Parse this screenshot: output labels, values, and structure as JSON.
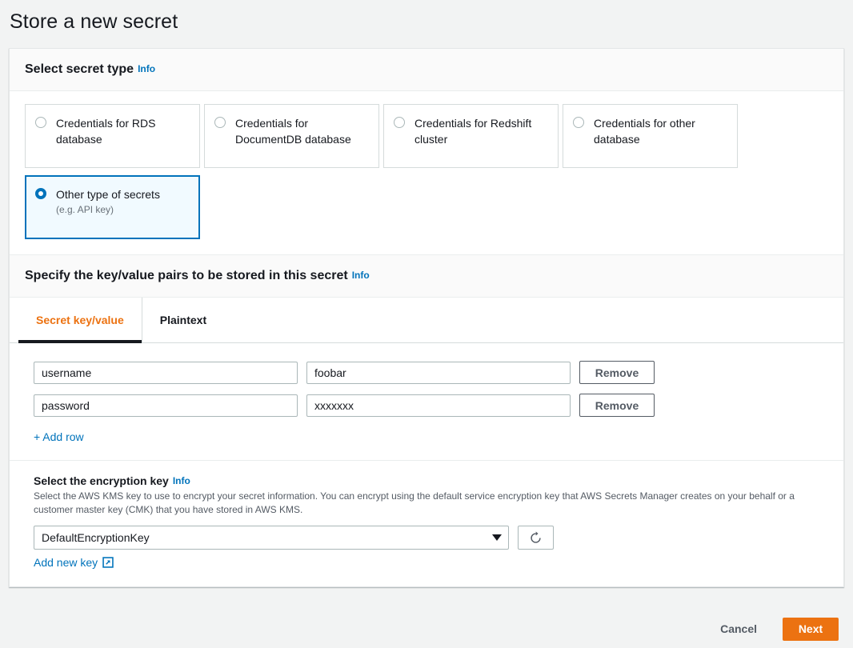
{
  "page": {
    "title": "Store a new secret"
  },
  "secret_type_section": {
    "heading": "Select secret type",
    "info_label": "Info",
    "options": [
      {
        "label": "Credentials for RDS database",
        "sub": "",
        "selected": false
      },
      {
        "label": "Credentials for DocumentDB database",
        "sub": "",
        "selected": false
      },
      {
        "label": "Credentials for Redshift cluster",
        "sub": "",
        "selected": false
      },
      {
        "label": "Credentials for other database",
        "sub": "",
        "selected": false
      },
      {
        "label": "Other type of secrets",
        "sub": "(e.g. API key)",
        "selected": true
      }
    ]
  },
  "keyvalue_section": {
    "heading": "Specify the key/value pairs to be stored in this secret",
    "info_label": "Info",
    "tabs": [
      {
        "label": "Secret key/value",
        "active": true
      },
      {
        "label": "Plaintext",
        "active": false
      }
    ],
    "rows": [
      {
        "key": "username",
        "value": "foobar",
        "remove_label": "Remove"
      },
      {
        "key": "password",
        "value": "xxxxxxx",
        "remove_label": "Remove"
      }
    ],
    "add_row_label": "+ Add row"
  },
  "encryption_section": {
    "heading": "Select the encryption key",
    "info_label": "Info",
    "description": "Select the AWS KMS key to use to encrypt your secret information. You can encrypt using the default service encryption key that AWS Secrets Manager creates on your behalf or a customer master key (CMK) that you have stored in AWS KMS.",
    "selected_key": "DefaultEncryptionKey",
    "refresh_icon": "refresh-icon",
    "add_new_key_label": "Add new key",
    "external_icon": "external-link-icon"
  },
  "footer": {
    "cancel_label": "Cancel",
    "next_label": "Next"
  },
  "colors": {
    "accent_orange": "#ec7211",
    "link_blue": "#0073bb",
    "selected_bg": "#f1faff",
    "page_bg": "#f2f3f3"
  }
}
